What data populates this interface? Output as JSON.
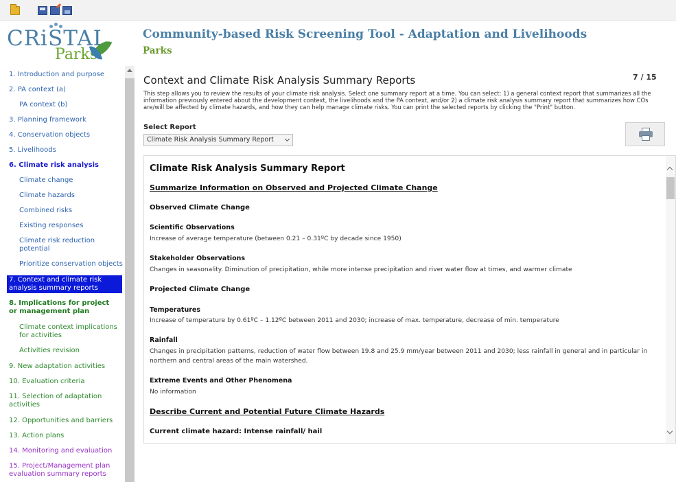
{
  "toolbar": {
    "buttons": [
      {
        "icon": "open-folder-icon"
      },
      {
        "icon": "save-icon"
      },
      {
        "icon": "save-as-icon"
      },
      {
        "icon": "export-icon"
      }
    ]
  },
  "header": {
    "logo_cristal": "CRiSTAL",
    "logo_parks": "Parks",
    "title": "Community-based Risk Screening Tool - Adaptation and Livelihoods",
    "subtitle": "Parks"
  },
  "sidebar": {
    "items": [
      {
        "label": "1. Introduction and purpose"
      },
      {
        "label": "2. PA context (a)"
      },
      {
        "label": "PA context (b)"
      },
      {
        "label": "3. Planning framework"
      },
      {
        "label": "4. Conservation objects"
      },
      {
        "label": "5. Livelihoods"
      },
      {
        "label": "6. Climate risk analysis"
      },
      {
        "label": "Climate change"
      },
      {
        "label": "Climate hazards"
      },
      {
        "label": "Combined risks"
      },
      {
        "label": "Existing responses"
      },
      {
        "label": "Climate risk reduction potential"
      },
      {
        "label": "Prioritize conservation objects"
      },
      {
        "label": "7. Context and climate risk analysis summary reports"
      },
      {
        "label": "8. Implications for project or management plan"
      },
      {
        "label": "Climate context implications for activities"
      },
      {
        "label": "Activities revision"
      },
      {
        "label": "9. New adaptation activities"
      },
      {
        "label": "10. Evaluation criteria"
      },
      {
        "label": "11. Selection of adaptation activities"
      },
      {
        "label": "12. Opportunities and barriers"
      },
      {
        "label": "13. Action plans"
      },
      {
        "label": "14. Monitoring and evaluation"
      },
      {
        "label": "15. Project/Management plan evaluation summary reports"
      }
    ]
  },
  "main": {
    "heading": "Context and Climate Risk Analysis Summary Reports",
    "page_counter": "7 / 15",
    "intro": "This step allows you to review the results of your climate risk analysis. Select one summary report at a time. You can select: 1) a general context report that summarizes all the information previously entered about the development context, the livelihoods and the PA context, and/or 2) a climate risk analysis summary report that summarizes how COs are/will be affected by climate hazards, and how they can help manage climate risks. You can print the selected reports by clicking the \"Print\" button.",
    "select_label": "Select Report",
    "select_value": "Climate Risk Analysis Summary Report"
  },
  "report": {
    "title": "Climate Risk Analysis Summary Report",
    "section1": "Summarize Information on Observed and Projected Climate Change",
    "observed_heading": "Observed Climate Change",
    "sci_obs_label": "Scientific Observations",
    "sci_obs_text": "Increase of average temperature (between 0.21 – 0.31ºC by decade since 1950)",
    "stake_obs_label": "Stakeholder Observations",
    "stake_obs_text": "Changes in seasonality. Diminution of precipitation, while more intense precipitation and river water flow at times, and warmer climate",
    "projected_heading": "Projected Climate Change",
    "temp_label": "Temperatures",
    "temp_text": "Increase of temperature by 0.61ºC – 1.12ºC between 2011 and 2030; increase of max. temperature, decrease of min. temperature",
    "rain_label": "Rainfall",
    "rain_text": "Changes in precipitation patterns, reduction of water flow between 19.8 and 25.9 mm/year between 2011 and 2030; less rainfall in general and in particular in northern and central areas of the main watershed.",
    "extreme_label": "Extreme Events and Other Phenomena",
    "extreme_text": "No information",
    "section2": "Describe Current and Potential Future Climate Hazards",
    "hazard_heading": "Current climate hazard: Intense rainfall/ hail"
  }
}
